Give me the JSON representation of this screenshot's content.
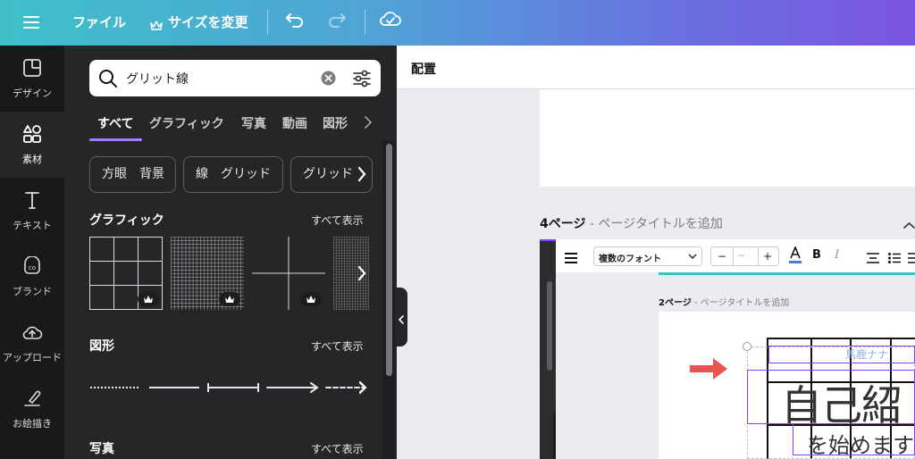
{
  "topbar": {
    "file_label": "ファイル",
    "resize_label": "サイズを変更"
  },
  "rail": {
    "items": [
      {
        "label": "デザイン",
        "icon": "design-icon"
      },
      {
        "label": "素材",
        "icon": "elements-icon"
      },
      {
        "label": "テキスト",
        "icon": "text-icon"
      },
      {
        "label": "ブランド",
        "icon": "brand-icon"
      },
      {
        "label": "アップロード",
        "icon": "upload-icon"
      },
      {
        "label": "お絵描き",
        "icon": "draw-icon"
      }
    ]
  },
  "search": {
    "value": "グリット線"
  },
  "tabs": [
    "すべて",
    "グラフィック",
    "写真",
    "動画",
    "図形"
  ],
  "chips": [
    "方眼　背景",
    "線　グリッド",
    "グリッド"
  ],
  "sections": {
    "graphics": {
      "title": "グラフィック",
      "see_all": "すべて表示"
    },
    "shapes": {
      "title": "図形",
      "see_all": "すべて表示"
    },
    "photos": {
      "title": "写真",
      "see_all": "すべて表示"
    }
  },
  "canvas": {
    "position_label": "配置",
    "page4_title": "4ページ",
    "page4_subtitle": " - ページタイトルを追加",
    "inner_toolbar": {
      "font": "複数のフォント",
      "size_value": "--"
    },
    "inner_page_title": "2ページ",
    "inner_page_subtitle": " - ページタイトルを追加",
    "name_text": "馬鹿ナナ",
    "heading_text": "自己紹",
    "subheading_text": "を始めます"
  },
  "colors": {
    "accent": "#8b3dff",
    "arrow": "#e8544f",
    "panel_bg": "#252627",
    "rail_bg": "#18191b"
  }
}
